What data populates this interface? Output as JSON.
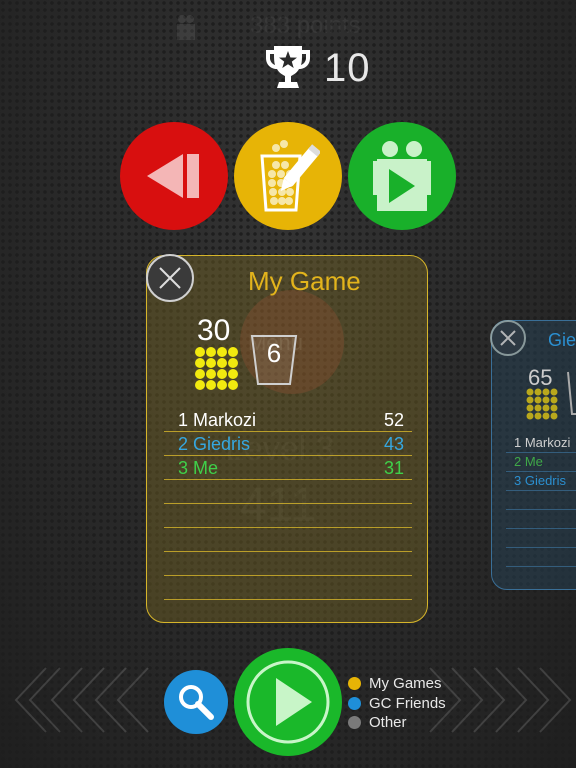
{
  "background": {
    "ghost_points": "383 points",
    "ghost_menu": "Menu",
    "ghost_level": "Level 3",
    "ghost_number": "411"
  },
  "header": {
    "trophy_icon": "trophy-icon",
    "trophy_count": "10"
  },
  "actions": {
    "back": {
      "icon": "back-icon",
      "color": "#d80f0f"
    },
    "new_game": {
      "icon": "cup-pencil-icon",
      "color": "#e7b406"
    },
    "friends": {
      "icon": "friends-play-icon",
      "color": "#19b02a"
    }
  },
  "game_card": {
    "title": "My Game",
    "title_color": "#e3b41c",
    "border_color": "#d6b52a",
    "score": "30",
    "cup_value": "6",
    "players": [
      {
        "rank_name": "1 Markozi",
        "points": "52",
        "color": "#ffffff"
      },
      {
        "rank_name": "2 Giedris",
        "points": "43",
        "color": "#36a7e0"
      },
      {
        "rank_name": "3 Me",
        "points": "31",
        "color": "#3fd04a"
      }
    ]
  },
  "second_card": {
    "title": "Gie",
    "score": "65",
    "players": [
      {
        "rank_name": "1 Markozi",
        "color": "#cfcfcf"
      },
      {
        "rank_name": "2 Me",
        "color": "#3fa848"
      },
      {
        "rank_name": "3 Giedris",
        "color": "#2b8fd0"
      }
    ]
  },
  "bottom": {
    "search_icon": "search-icon",
    "play_icon": "play-icon",
    "legend": [
      {
        "label": "My Games",
        "color": "#e7b406"
      },
      {
        "label": "GC Friends",
        "color": "#1f8fd8"
      },
      {
        "label": "Other",
        "color": "#7a7a7a"
      }
    ]
  }
}
